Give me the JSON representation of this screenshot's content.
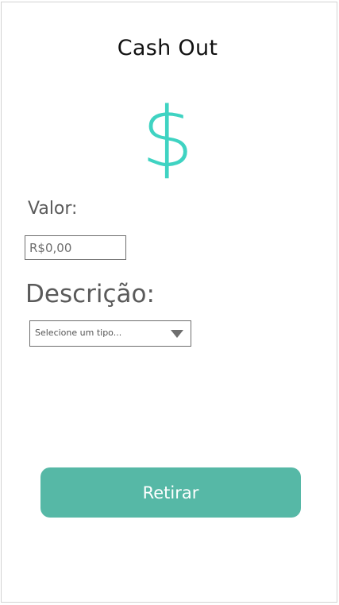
{
  "screen": {
    "title": "Cash Out"
  },
  "hero": {
    "symbol": "$",
    "icon": "dollar-sign-icon",
    "color": "#3fd3c2"
  },
  "valor": {
    "label": "Valor:",
    "placeholder": "R$0,00",
    "value": ""
  },
  "descricao": {
    "label": "Descrição:",
    "select_text": "Selecione um tipo...",
    "icon": "triangle-down-icon"
  },
  "actions": {
    "withdraw_label": "Retirar",
    "button_color": "#56b8a6"
  }
}
